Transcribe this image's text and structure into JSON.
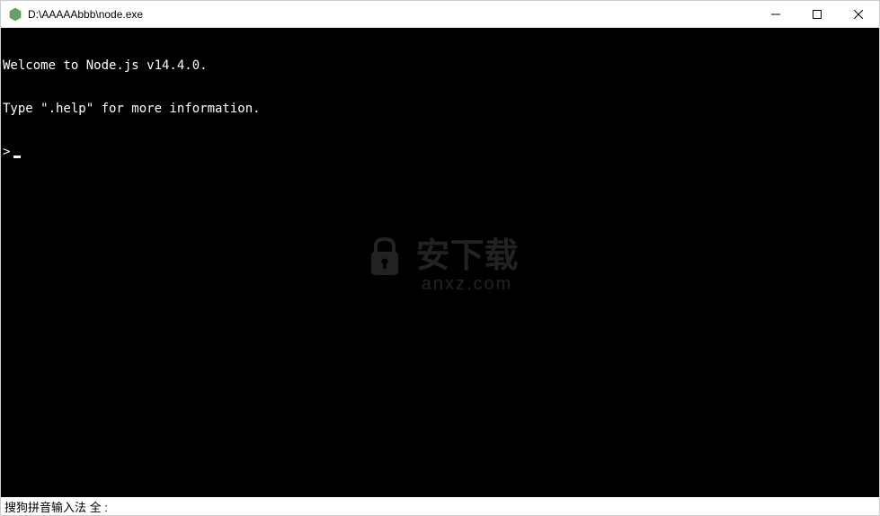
{
  "window": {
    "title": "D:\\AAAAAbbb\\node.exe"
  },
  "terminal": {
    "line1": "Welcome to Node.js v14.4.0.",
    "line2": "Type \".help\" for more information.",
    "prompt": ">"
  },
  "watermark": {
    "text": "安下载",
    "url": "anxz.com"
  },
  "ime": {
    "status": "搜狗拼音输入法 全 :"
  }
}
